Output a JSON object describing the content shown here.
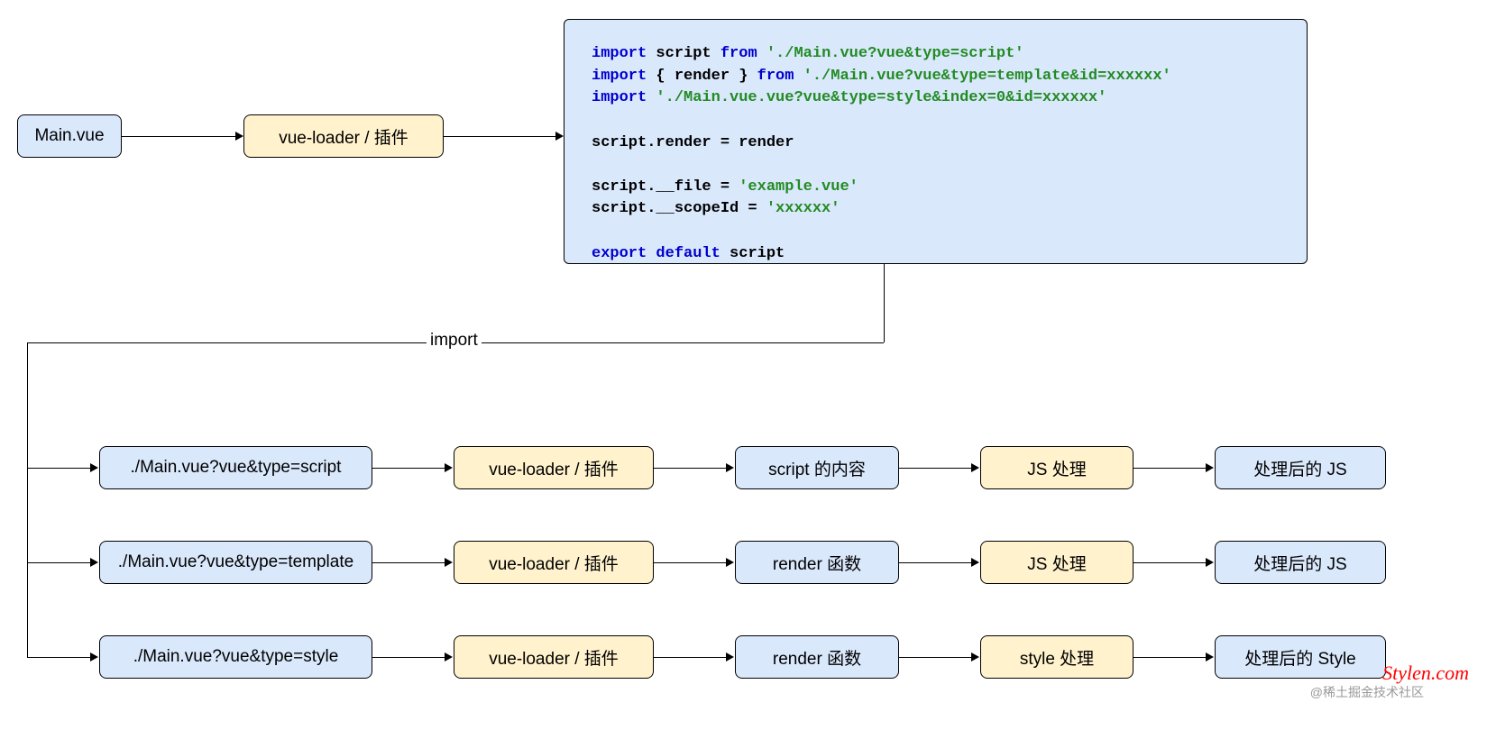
{
  "top": {
    "main_vue": "Main.vue",
    "loader": "vue-loader / 插件"
  },
  "code": {
    "l1_kw1": "import",
    "l1_plain1": " script ",
    "l1_kw2": "from",
    "l1_str": " './Main.vue?vue&type=script'",
    "l2_kw1": "import",
    "l2_plain1": " { render } ",
    "l2_kw2": "from",
    "l2_str": " './Main.vue?vue&type=template&id=xxxxxx'",
    "l3_kw1": "import",
    "l3_str": " './Main.vue.vue?vue&type=style&index=0&id=xxxxxx'",
    "l5": "script.render = render",
    "l7_pre": "script.__file = ",
    "l7_str": "'example.vue'",
    "l8_pre": "script.__scopeId = ",
    "l8_str": "'xxxxxx'",
    "l10_kw1": "export",
    "l10_kw2": " default",
    "l10_plain": " script"
  },
  "import_label": "import",
  "rows": [
    {
      "file": "./Main.vue?vue&type=script",
      "loader": "vue-loader / 插件",
      "content": "script 的内容",
      "process": "JS 处理",
      "result": "处理后的 JS"
    },
    {
      "file": "./Main.vue?vue&type=template",
      "loader": "vue-loader / 插件",
      "content": "render 函数",
      "process": "JS 处理",
      "result": "处理后的 JS"
    },
    {
      "file": "./Main.vue?vue&type=style",
      "loader": "vue-loader / 插件",
      "content": "render 函数",
      "process": "style 处理",
      "result": "处理后的 Style"
    }
  ],
  "watermark": "Stylen.com",
  "watermark2": "@稀土掘金技术社区"
}
